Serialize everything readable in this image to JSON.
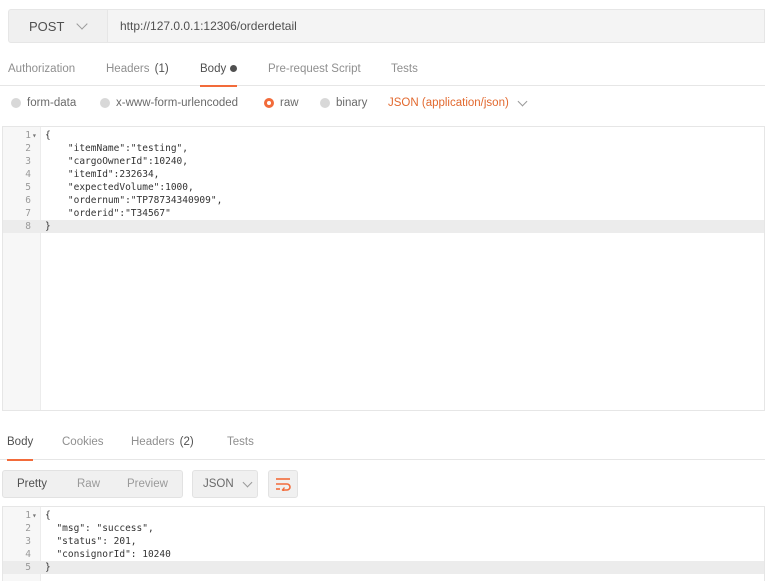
{
  "request": {
    "method": "POST",
    "url": "http://127.0.0.1:12306/orderdetail"
  },
  "request_tabs": [
    {
      "label": "Authorization"
    },
    {
      "label": "Headers",
      "count": "(1)"
    },
    {
      "label": "Body"
    },
    {
      "label": "Pre-request Script"
    },
    {
      "label": "Tests"
    }
  ],
  "body_types": {
    "form_data": "form-data",
    "urlencoded": "x-www-form-urlencoded",
    "raw": "raw",
    "binary": "binary",
    "content_type": "JSON (application/json)",
    "selected": "raw"
  },
  "request_body": {
    "lines": [
      {
        "n": "1",
        "fold": "▾",
        "text": "{"
      },
      {
        "n": "2",
        "text": "    \"itemName\":\"testing\","
      },
      {
        "n": "3",
        "text": "    \"cargoOwnerId\":10240,"
      },
      {
        "n": "4",
        "text": "    \"itemId\":232634,"
      },
      {
        "n": "5",
        "text": "    \"expectedVolume\":1000,"
      },
      {
        "n": "6",
        "text": "    \"ordernum\":\"TP78734340909\","
      },
      {
        "n": "7",
        "text": "    \"orderid\":\"T34567\""
      },
      {
        "n": "8",
        "text": "}"
      }
    ]
  },
  "response_tabs": [
    {
      "label": "Body"
    },
    {
      "label": "Cookies"
    },
    {
      "label": "Headers",
      "count": "(2)"
    },
    {
      "label": "Tests"
    }
  ],
  "response_view": {
    "pretty": "Pretty",
    "raw": "Raw",
    "preview": "Preview",
    "format": "JSON"
  },
  "response_body": {
    "lines": [
      {
        "n": "1",
        "fold": "▾",
        "text": "{"
      },
      {
        "n": "2",
        "text": "  \"msg\": \"success\","
      },
      {
        "n": "3",
        "text": "  \"status\": 201,"
      },
      {
        "n": "4",
        "text": "  \"consignorId\": 10240"
      },
      {
        "n": "5",
        "text": "}"
      }
    ]
  },
  "colors": {
    "accent": "#f26b3a",
    "content_type": "#e2692f"
  }
}
